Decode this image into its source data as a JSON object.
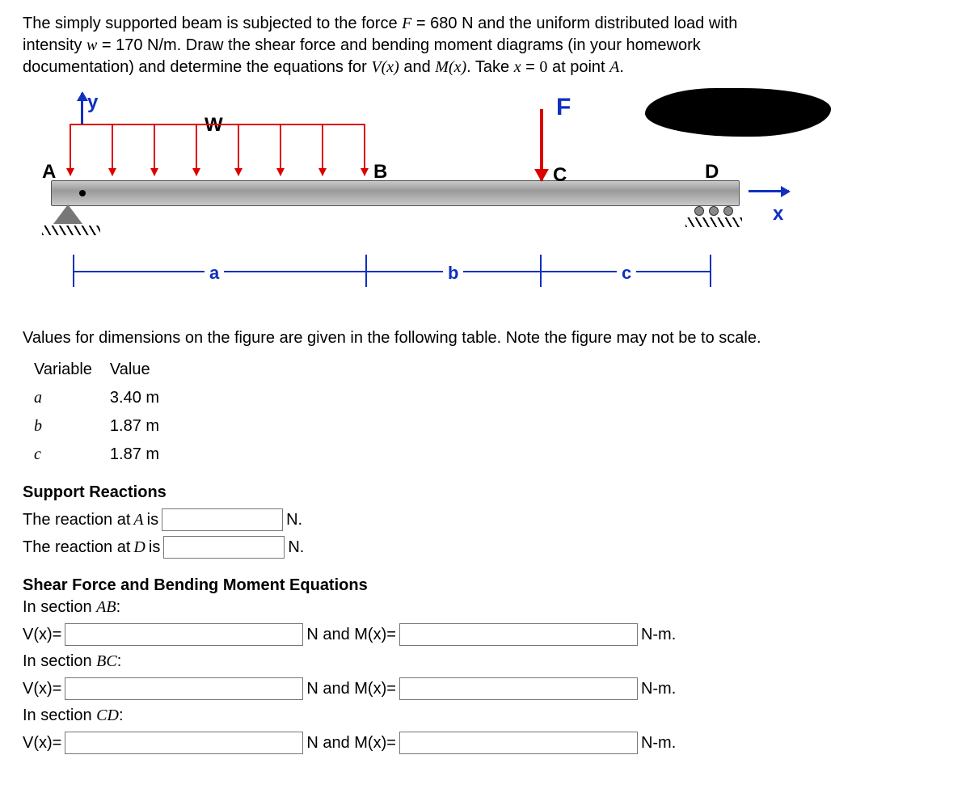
{
  "problem": {
    "line1_a": "The simply supported beam is subjected to the force ",
    "F_sym": "F",
    "eq1": " = ",
    "F_val": "680 N",
    "line1_b": " and the uniform distributed load with",
    "line2_a": "intensity ",
    "w_sym": "w",
    "eq2": " = ",
    "w_val": "170 N/m",
    "line2_b": ". Draw the shear force and bending moment diagrams (in your homework",
    "line3_a": "documentation) and determine the equations for ",
    "Vx": "V(x)",
    "and": " and ",
    "Mx": "M(x)",
    "line3_b": ". Take ",
    "x_sym": "x",
    "eq3": " = ",
    "zero": "0",
    "line3_c": " at point ",
    "A_sym": "A",
    "period": "."
  },
  "figure": {
    "y": "y",
    "W": "W",
    "F": "F",
    "A": "A",
    "B": "B",
    "C": "C",
    "D": "D",
    "x": "x",
    "dim_a": "a",
    "dim_b": "b",
    "dim_c": "c"
  },
  "dims_note": "Values for dimensions on the figure are given in the following table. Note the figure may not be to scale.",
  "table": {
    "h1": "Variable",
    "h2": "Value",
    "rows": [
      {
        "var": "a",
        "val": "3.40 m"
      },
      {
        "var": "b",
        "val": "1.87 m"
      },
      {
        "var": "c",
        "val": "1.87 m"
      }
    ]
  },
  "reactions": {
    "heading": "Support Reactions",
    "A_label_pre": "The reaction at ",
    "A_sym": "A",
    "A_label_post": " is",
    "D_label_pre": "The reaction at ",
    "D_sym": "D",
    "D_label_post": " is",
    "unit": "N."
  },
  "equations": {
    "heading": "Shear Force and Bending Moment Equations",
    "sec_AB_pre": "In section ",
    "sec_AB": "AB",
    "sec_BC": "BC",
    "sec_CD": "CD",
    "colon": ":",
    "V_lbl": "V(x)=",
    "M_lbl": "N and M(x)=",
    "M_unit": "N-m."
  }
}
